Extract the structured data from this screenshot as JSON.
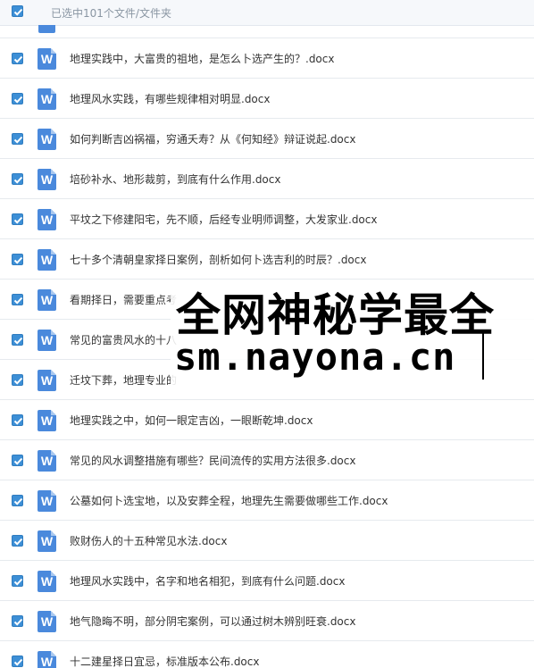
{
  "header": {
    "selection_text": "已选中101个文件/文件夹"
  },
  "files": [
    {
      "name": "地理实践中，大富贵的祖地，是怎么卜选产生的？.docx"
    },
    {
      "name": "地理风水实践，有哪些规律相对明显.docx"
    },
    {
      "name": "如何判断吉凶祸福，穷通夭寿？从《何知经》辩证说起.docx"
    },
    {
      "name": "培砂补水、地形裁剪，到底有什么作用.docx"
    },
    {
      "name": "平坟之下修建阳宅，先不顺，后经专业明师调整，大发家业.docx"
    },
    {
      "name": "七十多个清朝皇家择日案例，剖析如何卜选吉利的时辰？.docx"
    },
    {
      "name": "看期择日，需要重点考"
    },
    {
      "name": "常见的富贵风水的十八"
    },
    {
      "name": "迁坟下葬，地理专业的"
    },
    {
      "name": "地理实践之中，如何一眼定吉凶，一眼断乾坤.docx"
    },
    {
      "name": "常见的风水调整措施有哪些？民间流传的实用方法很多.docx"
    },
    {
      "name": "公墓如何卜选宝地，以及安葬全程，地理先生需要做哪些工作.docx"
    },
    {
      "name": "败财伤人的十五种常见水法.docx"
    },
    {
      "name": "地理风水实践中，名字和地名相犯，到底有什么问题.docx"
    },
    {
      "name": "地气隐晦不明，部分阴宅案例，可以通过树木辨别旺衰.docx"
    },
    {
      "name": "十二建星择日宜忌，标准版本公布.docx"
    }
  ],
  "file_icon_letter": "W",
  "watermark": {
    "line1": "全网神秘学最全",
    "line2": "sm.nayona.cn"
  },
  "colors": {
    "checkbox": "#3d8fd6",
    "doc_icon": "#4a89dc",
    "header_bg": "#f6f8fb"
  }
}
